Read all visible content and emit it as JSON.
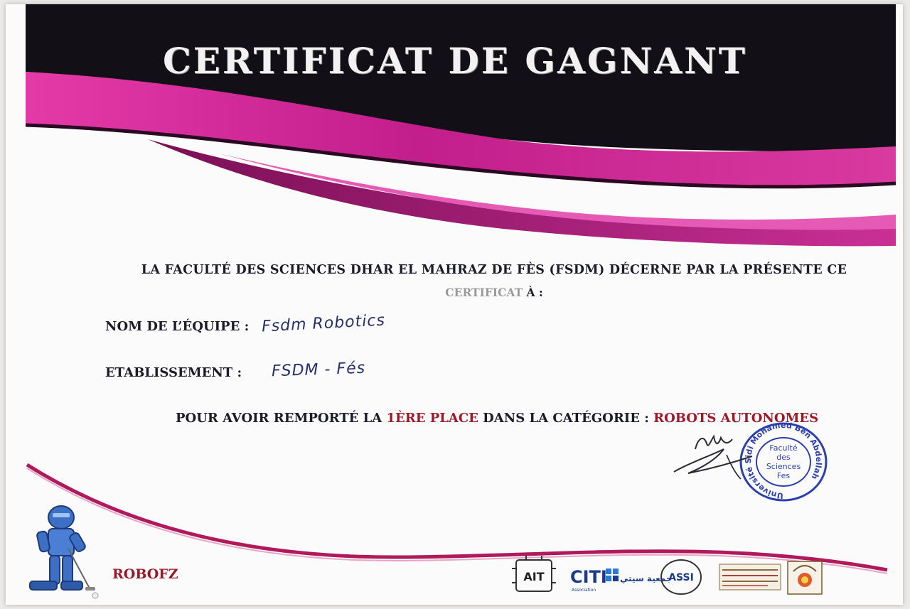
{
  "certificate": {
    "title": "CERTIFICAT DE GAGNANT",
    "intro_line1": "LA FACULTÉ DES SCIENCES DHAR EL MAHRAZ DE FÈS (FSDM) DÉCERNE PAR LA PRÉSENTE CE",
    "intro_line2_word": "CERTIFICAT",
    "intro_line2_rest": " À :",
    "team_label": "NOM DE L’ÉQUIPE :",
    "team_value": "Fsdm Robotics",
    "establishment_label": "ETABLISSEMENT :",
    "establishment_value": "FSDM - Fés",
    "award_prefix": "POUR AVOIR REMPORTÉ LA ",
    "award_place": "1ÈRE PLACE",
    "award_mid": " DANS LA CATÉGORIE : ",
    "award_category": "ROBOTS AUTONOMES",
    "event_name": "ROBOFZ"
  },
  "stamp": {
    "ring_text": "Université Sidi Mohamed Ben Abdellah",
    "center_lines": [
      "Faculté",
      "des",
      "Sciences",
      "Fes"
    ]
  },
  "logos": {
    "ait": "AIT",
    "citi": "CITI",
    "citi_sub": "Association",
    "citi_arabic": "جمعية سيتي",
    "assi": "ASSI"
  },
  "colors": {
    "banner_black": "#121016",
    "wave_magenta": "#d42a9c",
    "accent_red": "#a01828",
    "stamp_blue": "#2b3fae"
  }
}
